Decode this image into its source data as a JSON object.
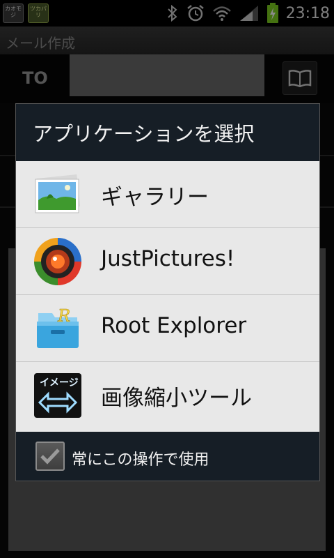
{
  "status_bar": {
    "notifications": [
      {
        "name": "kaomoji-notification-icon",
        "label": "カオモジ"
      },
      {
        "name": "app-notification-icon",
        "label": "ツカパリ"
      }
    ],
    "icons": [
      "bluetooth-icon",
      "alarm-icon",
      "wifi-icon",
      "signal-icon",
      "battery-charging-icon"
    ],
    "time": "23:18"
  },
  "compose": {
    "title": "メール作成",
    "to_label": "TO",
    "to_value": ""
  },
  "dialog": {
    "title": "アプリケーションを選択",
    "apps": [
      {
        "label": "ギャラリー",
        "icon": "gallery-icon"
      },
      {
        "label": "JustPictures!",
        "icon": "justpictures-icon"
      },
      {
        "label": "Root Explorer",
        "icon": "root-explorer-icon"
      },
      {
        "label": "画像縮小ツール",
        "icon": "image-resize-icon"
      }
    ],
    "always_use_label": "常にこの操作で使用",
    "always_use_checked": true,
    "image_resize_icon_text": "イメージ"
  },
  "colors": {
    "dialog_header": "#161e26",
    "list_background": "#e8e8e8",
    "battery": "#7ecf1f"
  }
}
